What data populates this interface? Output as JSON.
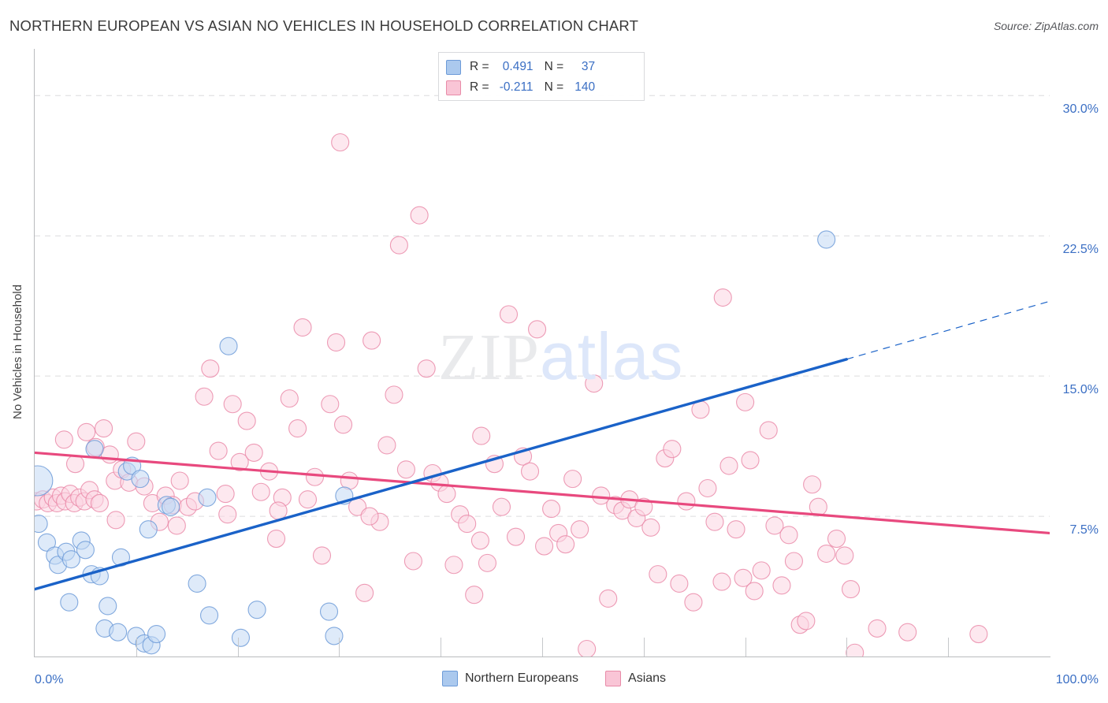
{
  "header": {
    "title": "NORTHERN EUROPEAN VS ASIAN NO VEHICLES IN HOUSEHOLD CORRELATION CHART",
    "source": "Source: ZipAtlas.com"
  },
  "axes": {
    "y_title": "No Vehicles in Household",
    "y_ticks": [
      "30.0%",
      "22.5%",
      "15.0%",
      "7.5%"
    ],
    "x_min_label": "0.0%",
    "x_max_label": "100.0%"
  },
  "stats": {
    "rows": [
      {
        "series": "Northern Europeans",
        "r_label": "R =",
        "r_value": "0.491",
        "n_label": "N =",
        "n_value": "37",
        "color": "#abc9ee"
      },
      {
        "series": "Asians",
        "r_label": "R =",
        "r_value": "-0.211",
        "n_label": "N =",
        "n_value": "140",
        "color": "#f9c5d6"
      }
    ]
  },
  "legend": {
    "items": [
      {
        "label": "Northern Europeans",
        "color": "#abc9ee"
      },
      {
        "label": "Asians",
        "color": "#f9c5d6"
      }
    ]
  },
  "watermark": {
    "part1": "ZIP",
    "part2": "atlas"
  },
  "colors": {
    "blue_fill": "#c3d9f4",
    "blue_stroke": "#6d9bd8",
    "pink_fill": "#fbd5e2",
    "pink_stroke": "#ea8ba9",
    "blue_line": "#1a62c8",
    "pink_line": "#e8497e",
    "tick_text": "#3b6fc4",
    "grid": "#dcdcde"
  },
  "chart_data": {
    "type": "scatter",
    "title": "NORTHERN EUROPEAN VS ASIAN NO VEHICLES IN HOUSEHOLD CORRELATION CHART",
    "xlabel": "",
    "ylabel": "No Vehicles in Household",
    "xlim": [
      0,
      100
    ],
    "ylim": [
      0,
      32.5
    ],
    "x_ticks": [
      0,
      10,
      20,
      30,
      40,
      50,
      60,
      70,
      80,
      90,
      100
    ],
    "y_gridlines": [
      7.5,
      15.0,
      22.5,
      30.0
    ],
    "grid": true,
    "legend_position": "bottom-center",
    "series": [
      {
        "name": "Northern Europeans",
        "color": "#c3d9f4",
        "r": 0.491,
        "n": 37,
        "trendline": {
          "x0": 0,
          "y0": 3.6,
          "x1": 80,
          "y1": 15.9,
          "solid_to_x": 80,
          "dashed_to": {
            "x": 100,
            "y": 19.0
          }
        },
        "points": [
          {
            "x": 0.3,
            "y": 9.4,
            "r": 19
          },
          {
            "x": 0.4,
            "y": 7.1,
            "r": 11
          },
          {
            "x": 1.2,
            "y": 6.1,
            "r": 11
          },
          {
            "x": 2.0,
            "y": 5.4,
            "r": 11
          },
          {
            "x": 2.3,
            "y": 4.9,
            "r": 11
          },
          {
            "x": 3.1,
            "y": 5.6,
            "r": 11
          },
          {
            "x": 3.6,
            "y": 5.2,
            "r": 11
          },
          {
            "x": 4.6,
            "y": 6.2,
            "r": 11
          },
          {
            "x": 5.0,
            "y": 5.7,
            "r": 11
          },
          {
            "x": 3.4,
            "y": 2.9,
            "r": 11
          },
          {
            "x": 5.6,
            "y": 4.4,
            "r": 11
          },
          {
            "x": 6.4,
            "y": 4.3,
            "r": 11
          },
          {
            "x": 7.2,
            "y": 2.7,
            "r": 11
          },
          {
            "x": 6.9,
            "y": 1.5,
            "r": 11
          },
          {
            "x": 8.2,
            "y": 1.3,
            "r": 11
          },
          {
            "x": 5.9,
            "y": 11.1,
            "r": 11
          },
          {
            "x": 8.5,
            "y": 5.3,
            "r": 11
          },
          {
            "x": 9.1,
            "y": 9.9,
            "r": 11
          },
          {
            "x": 9.6,
            "y": 10.2,
            "r": 11
          },
          {
            "x": 10.0,
            "y": 1.1,
            "r": 11
          },
          {
            "x": 10.4,
            "y": 9.5,
            "r": 11
          },
          {
            "x": 10.8,
            "y": 0.7,
            "r": 11
          },
          {
            "x": 11.5,
            "y": 0.6,
            "r": 11
          },
          {
            "x": 12.0,
            "y": 1.2,
            "r": 11
          },
          {
            "x": 11.2,
            "y": 6.8,
            "r": 11
          },
          {
            "x": 13.0,
            "y": 8.1,
            "r": 11
          },
          {
            "x": 13.4,
            "y": 8.0,
            "r": 11
          },
          {
            "x": 16.0,
            "y": 3.9,
            "r": 11
          },
          {
            "x": 17.0,
            "y": 8.5,
            "r": 11
          },
          {
            "x": 17.2,
            "y": 2.2,
            "r": 11
          },
          {
            "x": 19.1,
            "y": 16.6,
            "r": 11
          },
          {
            "x": 20.3,
            "y": 1.0,
            "r": 11
          },
          {
            "x": 21.9,
            "y": 2.5,
            "r": 11
          },
          {
            "x": 29.0,
            "y": 2.4,
            "r": 11
          },
          {
            "x": 29.5,
            "y": 1.1,
            "r": 11
          },
          {
            "x": 30.5,
            "y": 8.6,
            "r": 11
          },
          {
            "x": 78.0,
            "y": 22.3,
            "r": 11
          }
        ]
      },
      {
        "name": "Asians",
        "color": "#fbd5e2",
        "r": -0.211,
        "n": 140,
        "trendline": {
          "x0": 0,
          "y0": 10.9,
          "x1": 100,
          "y1": 6.6
        },
        "points": [
          {
            "x": 0.2,
            "y": 8.3,
            "r": 11
          },
          {
            "x": 0.8,
            "y": 8.4,
            "r": 11
          },
          {
            "x": 1.3,
            "y": 8.2,
            "r": 11
          },
          {
            "x": 1.8,
            "y": 8.5,
            "r": 11
          },
          {
            "x": 2.2,
            "y": 8.2,
            "r": 11
          },
          {
            "x": 2.6,
            "y": 8.6,
            "r": 11
          },
          {
            "x": 3.0,
            "y": 8.3,
            "r": 11
          },
          {
            "x": 3.5,
            "y": 8.7,
            "r": 11
          },
          {
            "x": 3.9,
            "y": 8.2,
            "r": 11
          },
          {
            "x": 4.4,
            "y": 8.5,
            "r": 11
          },
          {
            "x": 4.9,
            "y": 8.3,
            "r": 11
          },
          {
            "x": 5.4,
            "y": 8.9,
            "r": 11
          },
          {
            "x": 5.9,
            "y": 8.4,
            "r": 11
          },
          {
            "x": 6.4,
            "y": 8.2,
            "r": 11
          },
          {
            "x": 2.9,
            "y": 11.6,
            "r": 11
          },
          {
            "x": 4.0,
            "y": 10.3,
            "r": 11
          },
          {
            "x": 5.1,
            "y": 12.0,
            "r": 11
          },
          {
            "x": 6.0,
            "y": 11.2,
            "r": 11
          },
          {
            "x": 6.8,
            "y": 12.2,
            "r": 11
          },
          {
            "x": 7.4,
            "y": 10.8,
            "r": 11
          },
          {
            "x": 7.9,
            "y": 9.4,
            "r": 11
          },
          {
            "x": 8.6,
            "y": 10.0,
            "r": 11
          },
          {
            "x": 9.3,
            "y": 9.3,
            "r": 11
          },
          {
            "x": 10.0,
            "y": 11.5,
            "r": 11
          },
          {
            "x": 10.8,
            "y": 9.1,
            "r": 11
          },
          {
            "x": 11.6,
            "y": 8.2,
            "r": 11
          },
          {
            "x": 12.3,
            "y": 7.2,
            "r": 11
          },
          {
            "x": 12.9,
            "y": 8.6,
            "r": 11
          },
          {
            "x": 13.6,
            "y": 8.1,
            "r": 11
          },
          {
            "x": 14.3,
            "y": 9.4,
            "r": 11
          },
          {
            "x": 15.1,
            "y": 8.0,
            "r": 11
          },
          {
            "x": 15.8,
            "y": 8.3,
            "r": 11
          },
          {
            "x": 16.7,
            "y": 13.9,
            "r": 11
          },
          {
            "x": 17.3,
            "y": 15.4,
            "r": 11
          },
          {
            "x": 18.1,
            "y": 11.0,
            "r": 11
          },
          {
            "x": 18.8,
            "y": 8.7,
            "r": 11
          },
          {
            "x": 19.5,
            "y": 13.5,
            "r": 11
          },
          {
            "x": 20.2,
            "y": 10.4,
            "r": 11
          },
          {
            "x": 20.9,
            "y": 12.6,
            "r": 11
          },
          {
            "x": 21.6,
            "y": 10.9,
            "r": 11
          },
          {
            "x": 22.3,
            "y": 8.8,
            "r": 11
          },
          {
            "x": 23.1,
            "y": 9.9,
            "r": 11
          },
          {
            "x": 23.8,
            "y": 6.3,
            "r": 11
          },
          {
            "x": 24.4,
            "y": 8.5,
            "r": 11
          },
          {
            "x": 25.1,
            "y": 13.8,
            "r": 11
          },
          {
            "x": 25.9,
            "y": 12.2,
            "r": 11
          },
          {
            "x": 26.4,
            "y": 17.6,
            "r": 11
          },
          {
            "x": 26.9,
            "y": 8.4,
            "r": 11
          },
          {
            "x": 27.6,
            "y": 9.6,
            "r": 11
          },
          {
            "x": 28.3,
            "y": 5.4,
            "r": 11
          },
          {
            "x": 29.1,
            "y": 13.5,
            "r": 11
          },
          {
            "x": 29.7,
            "y": 16.8,
            "r": 11
          },
          {
            "x": 30.4,
            "y": 12.4,
            "r": 11
          },
          {
            "x": 30.1,
            "y": 27.5,
            "r": 11
          },
          {
            "x": 31.0,
            "y": 9.4,
            "r": 11
          },
          {
            "x": 31.8,
            "y": 8.0,
            "r": 11
          },
          {
            "x": 32.5,
            "y": 3.4,
            "r": 11
          },
          {
            "x": 33.2,
            "y": 16.9,
            "r": 11
          },
          {
            "x": 34.0,
            "y": 7.2,
            "r": 11
          },
          {
            "x": 34.7,
            "y": 11.3,
            "r": 11
          },
          {
            "x": 35.4,
            "y": 14.0,
            "r": 11
          },
          {
            "x": 35.9,
            "y": 22.0,
            "r": 11
          },
          {
            "x": 36.6,
            "y": 10.0,
            "r": 11
          },
          {
            "x": 37.3,
            "y": 5.1,
            "r": 11
          },
          {
            "x": 37.9,
            "y": 23.6,
            "r": 11
          },
          {
            "x": 38.6,
            "y": 15.4,
            "r": 11
          },
          {
            "x": 39.2,
            "y": 9.8,
            "r": 11
          },
          {
            "x": 39.9,
            "y": 9.3,
            "r": 11
          },
          {
            "x": 40.6,
            "y": 8.7,
            "r": 11
          },
          {
            "x": 41.3,
            "y": 4.9,
            "r": 11
          },
          {
            "x": 41.9,
            "y": 7.6,
            "r": 11
          },
          {
            "x": 42.6,
            "y": 7.1,
            "r": 11
          },
          {
            "x": 43.3,
            "y": 3.3,
            "r": 11
          },
          {
            "x": 43.9,
            "y": 6.2,
            "r": 11
          },
          {
            "x": 44.6,
            "y": 5.0,
            "r": 11
          },
          {
            "x": 45.3,
            "y": 10.3,
            "r": 11
          },
          {
            "x": 46.0,
            "y": 8.0,
            "r": 11
          },
          {
            "x": 46.7,
            "y": 18.3,
            "r": 11
          },
          {
            "x": 47.4,
            "y": 6.4,
            "r": 11
          },
          {
            "x": 48.1,
            "y": 10.7,
            "r": 11
          },
          {
            "x": 48.8,
            "y": 9.9,
            "r": 11
          },
          {
            "x": 49.5,
            "y": 17.5,
            "r": 11
          },
          {
            "x": 50.2,
            "y": 5.9,
            "r": 11
          },
          {
            "x": 50.9,
            "y": 7.9,
            "r": 11
          },
          {
            "x": 51.6,
            "y": 6.6,
            "r": 11
          },
          {
            "x": 52.3,
            "y": 6.0,
            "r": 11
          },
          {
            "x": 53.0,
            "y": 9.5,
            "r": 11
          },
          {
            "x": 53.7,
            "y": 6.8,
            "r": 11
          },
          {
            "x": 54.4,
            "y": 0.4,
            "r": 11
          },
          {
            "x": 55.1,
            "y": 14.6,
            "r": 11
          },
          {
            "x": 55.8,
            "y": 8.6,
            "r": 11
          },
          {
            "x": 56.5,
            "y": 3.1,
            "r": 11
          },
          {
            "x": 57.2,
            "y": 8.1,
            "r": 11
          },
          {
            "x": 57.9,
            "y": 7.8,
            "r": 11
          },
          {
            "x": 58.6,
            "y": 8.4,
            "r": 11
          },
          {
            "x": 59.3,
            "y": 7.4,
            "r": 11
          },
          {
            "x": 60.0,
            "y": 8.0,
            "r": 11
          },
          {
            "x": 60.7,
            "y": 6.9,
            "r": 11
          },
          {
            "x": 61.4,
            "y": 4.4,
            "r": 11
          },
          {
            "x": 62.1,
            "y": 10.6,
            "r": 11
          },
          {
            "x": 62.8,
            "y": 11.1,
            "r": 11
          },
          {
            "x": 63.5,
            "y": 3.9,
            "r": 11
          },
          {
            "x": 64.2,
            "y": 8.3,
            "r": 11
          },
          {
            "x": 64.9,
            "y": 2.9,
            "r": 11
          },
          {
            "x": 65.6,
            "y": 13.2,
            "r": 11
          },
          {
            "x": 66.3,
            "y": 9.0,
            "r": 11
          },
          {
            "x": 67.0,
            "y": 7.2,
            "r": 11
          },
          {
            "x": 67.7,
            "y": 4.0,
            "r": 11
          },
          {
            "x": 68.4,
            "y": 10.2,
            "r": 11
          },
          {
            "x": 69.1,
            "y": 6.8,
            "r": 11
          },
          {
            "x": 69.8,
            "y": 4.2,
            "r": 11
          },
          {
            "x": 70.5,
            "y": 10.5,
            "r": 11
          },
          {
            "x": 70.9,
            "y": 3.5,
            "r": 11
          },
          {
            "x": 71.6,
            "y": 4.6,
            "r": 11
          },
          {
            "x": 72.3,
            "y": 12.1,
            "r": 11
          },
          {
            "x": 72.9,
            "y": 7.0,
            "r": 11
          },
          {
            "x": 73.6,
            "y": 3.8,
            "r": 11
          },
          {
            "x": 74.3,
            "y": 6.5,
            "r": 11
          },
          {
            "x": 74.8,
            "y": 5.1,
            "r": 11
          },
          {
            "x": 75.4,
            "y": 1.7,
            "r": 11
          },
          {
            "x": 76.0,
            "y": 1.9,
            "r": 11
          },
          {
            "x": 76.6,
            "y": 9.2,
            "r": 11
          },
          {
            "x": 77.2,
            "y": 8.0,
            "r": 11
          },
          {
            "x": 67.8,
            "y": 19.2,
            "r": 11
          },
          {
            "x": 70.0,
            "y": 13.6,
            "r": 11
          },
          {
            "x": 78.0,
            "y": 5.5,
            "r": 11
          },
          {
            "x": 79.0,
            "y": 6.3,
            "r": 11
          },
          {
            "x": 79.8,
            "y": 5.4,
            "r": 11
          },
          {
            "x": 80.4,
            "y": 3.6,
            "r": 11
          },
          {
            "x": 80.8,
            "y": 0.2,
            "r": 11
          },
          {
            "x": 83.0,
            "y": 1.5,
            "r": 11
          },
          {
            "x": 86.0,
            "y": 1.3,
            "r": 11
          },
          {
            "x": 93.0,
            "y": 1.2,
            "r": 11
          },
          {
            "x": 8.0,
            "y": 7.3,
            "r": 11
          },
          {
            "x": 14.0,
            "y": 7.0,
            "r": 11
          },
          {
            "x": 19.0,
            "y": 7.6,
            "r": 11
          },
          {
            "x": 24.0,
            "y": 7.8,
            "r": 11
          },
          {
            "x": 33.0,
            "y": 7.5,
            "r": 11
          },
          {
            "x": 44.0,
            "y": 11.8,
            "r": 11
          }
        ]
      }
    ]
  }
}
